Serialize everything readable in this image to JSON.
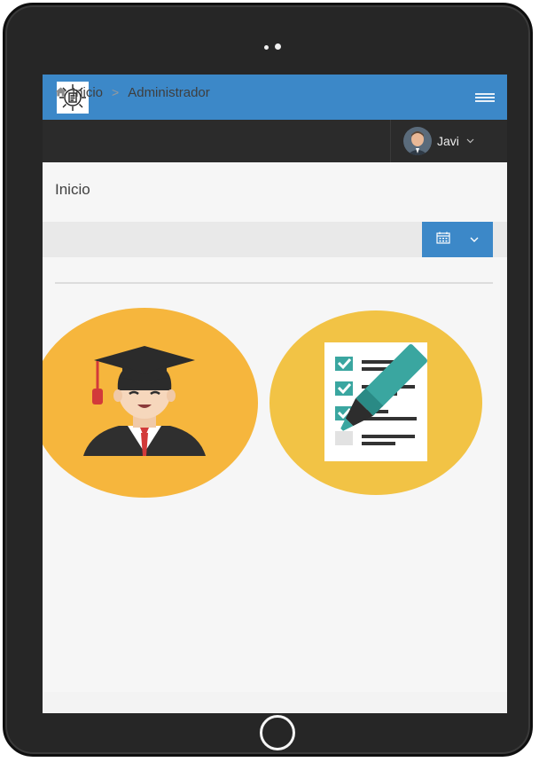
{
  "header": {
    "logo_icon": "gear-emblem-logo",
    "menu_icon": "hamburger-menu-icon",
    "brand_color": "#3c88c8"
  },
  "user": {
    "name": "Javi",
    "avatar_icon": "user-avatar-photo",
    "caret_icon": "chevron-down-icon"
  },
  "page": {
    "title": "Inicio"
  },
  "breadcrumb": {
    "home_icon": "home-icon",
    "home_label": "Inicio",
    "separator": ">",
    "current": "Administrador"
  },
  "toolbar": {
    "date_button_icon": "calendar-icon",
    "date_button_caret": "chevron-down-icon"
  },
  "tiles": [
    {
      "icon": "graduate-student-icon",
      "color": "#f6b63d"
    },
    {
      "icon": "checklist-marker-icon",
      "color": "#f2c345"
    }
  ]
}
